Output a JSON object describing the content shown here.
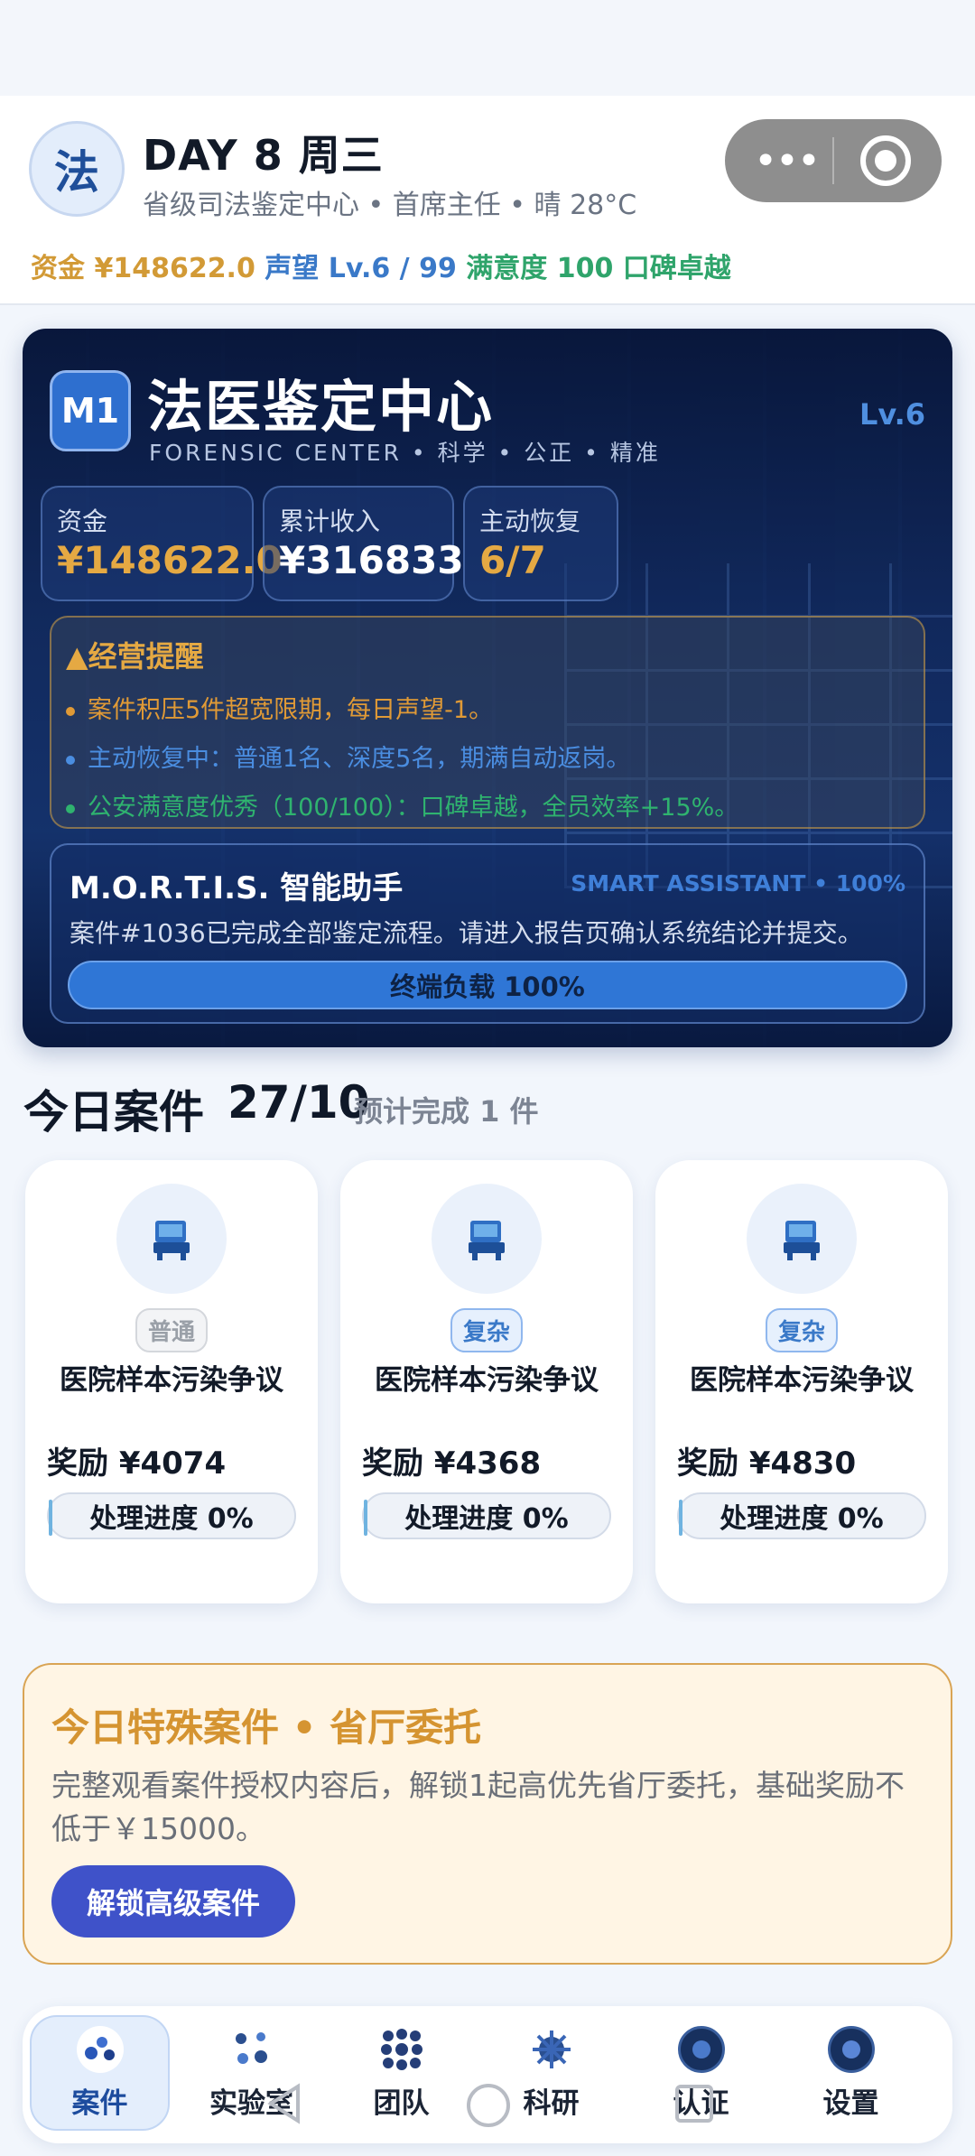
{
  "header": {
    "logo_char": "法",
    "day_title": "DAY 8  周三",
    "subline": "省级司法鉴定中心 • 首席主任 • 晴 28°C",
    "money": "资金 ¥148622.0",
    "reputation": "声望 Lv.6 / 99",
    "satisfaction": "满意度 100 口碑卓越"
  },
  "hero": {
    "badge": "M1",
    "title": "法医鉴定中心",
    "subtitle": "FORENSIC CENTER • 科学 • 公正 • 精准",
    "level": "Lv.6",
    "kpis": [
      {
        "label": "资金",
        "value": "¥148622.0"
      },
      {
        "label": "累计收入",
        "value": "¥316833"
      },
      {
        "label": "主动恢复",
        "value": "6/7"
      }
    ],
    "warning": {
      "title": "▲经营提醒",
      "items": [
        "案件积压5件超宽限期，每日声望-1。",
        "主动恢复中：普通1名、深度5名，期满自动返岗。",
        "公安满意度优秀（100/100）：口碑卓越，全员效率+15%。"
      ]
    },
    "assistant": {
      "title": "M.O.R.T.I.S. 智能助手",
      "tag": "SMART ASSISTANT • 100%",
      "message": "案件#1036已完成全部鉴定流程。请进入报告页确认系统结论并提交。",
      "load_label": "终端负载 100%",
      "load_percent": 100
    }
  },
  "cases_section": {
    "title": "今日案件",
    "count": "27/10",
    "estimate": "预计完成 1 件"
  },
  "cases": [
    {
      "badge": "普通",
      "title": "医院样本污染争议",
      "reward": "奖励 ¥4074",
      "progress": "处理进度 0%",
      "progress_value": 0
    },
    {
      "badge": "复杂",
      "title": "医院样本污染争议",
      "reward": "奖励 ¥4368",
      "progress": "处理进度 0%",
      "progress_value": 0
    },
    {
      "badge": "复杂",
      "title": "医院样本污染争议",
      "reward": "奖励 ¥4830",
      "progress": "处理进度 0%",
      "progress_value": 0
    }
  ],
  "special": {
    "title": "今日特殊案件 • 省厅委托",
    "description": "完整观看案件授权内容后，解锁1起高优先省厅委托，基础奖励不低于￥15000。",
    "button": "解锁高级案件"
  },
  "tabs": [
    {
      "label": "案件",
      "icon": "molecule-icon",
      "active": true
    },
    {
      "label": "实验室",
      "icon": "lab-icon",
      "active": false
    },
    {
      "label": "团队",
      "icon": "team-icon",
      "active": false
    },
    {
      "label": "科研",
      "icon": "research-icon",
      "active": false
    },
    {
      "label": "认证",
      "icon": "certificate-icon",
      "active": false
    },
    {
      "label": "设置",
      "icon": "settings-icon",
      "active": false
    }
  ],
  "colors": {
    "accent_blue": "#3f52c9",
    "gold": "#e5a943",
    "green": "#2fa46b",
    "hero_bg": "#102a5a"
  }
}
